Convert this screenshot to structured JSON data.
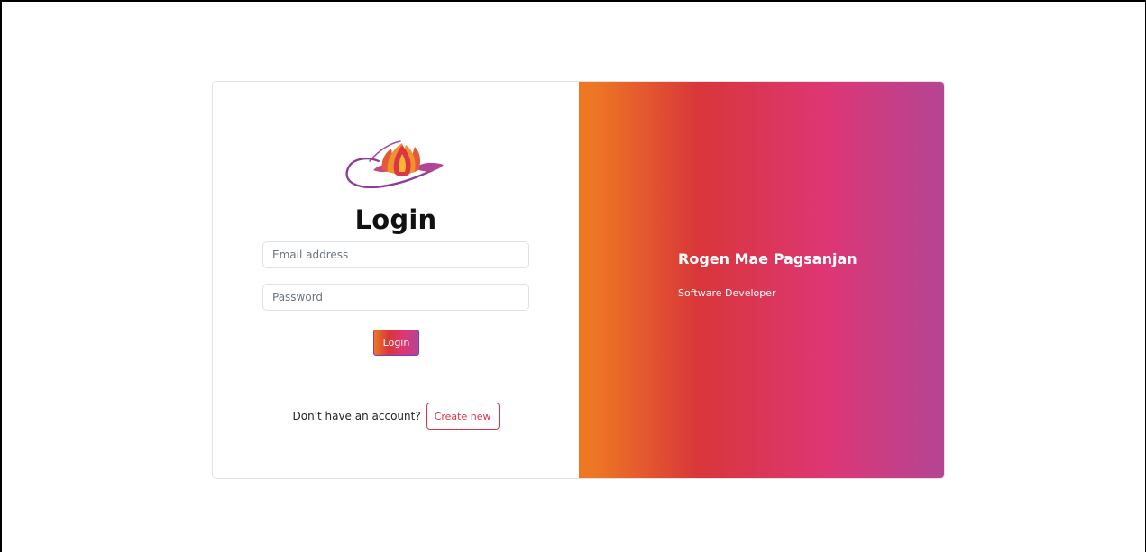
{
  "login_form": {
    "logo_icon": "lotus-logo-icon",
    "title": "Login",
    "email_placeholder": "Email address",
    "password_placeholder": "Password",
    "submit_label": "Login",
    "signup_prompt": "Don't have an account?",
    "signup_label": "Create new"
  },
  "brand_panel": {
    "name": "Rogen Mae Pagsanjan",
    "role": "Software Developer"
  },
  "colors": {
    "gradient": [
      "#ee7724",
      "#d8363a",
      "#dd3675",
      "#b44593"
    ],
    "create_button": "#dc3545"
  }
}
